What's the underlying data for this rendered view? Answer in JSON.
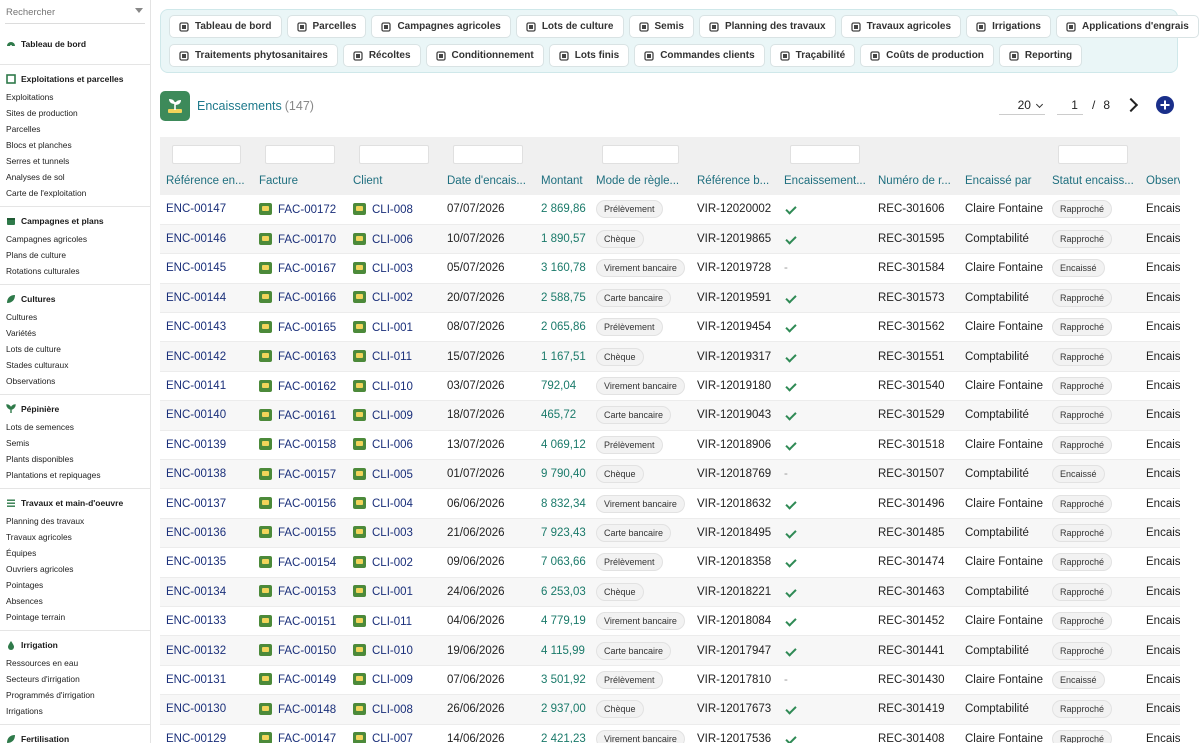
{
  "sidebar": {
    "search_placeholder": "Rechercher",
    "dashboard": "Tableau de bord",
    "groups": [
      {
        "title": "Exploitations et parcelles",
        "items": [
          "Exploitations",
          "Sites de production",
          "Parcelles",
          "Blocs et planches",
          "Serres et tunnels",
          "Analyses de sol",
          "Carte de l'exploitation"
        ]
      },
      {
        "title": "Campagnes et plans",
        "items": [
          "Campagnes agricoles",
          "Plans de culture",
          "Rotations culturales"
        ]
      },
      {
        "title": "Cultures",
        "items": [
          "Cultures",
          "Variétés",
          "Lots de culture",
          "Stades culturaux",
          "Observations"
        ]
      },
      {
        "title": "Pépinière",
        "items": [
          "Lots de semences",
          "Semis",
          "Plants disponibles",
          "Plantations et repiquages"
        ]
      },
      {
        "title": "Travaux et main-d'oeuvre",
        "items": [
          "Planning des travaux",
          "Travaux agricoles",
          "Équipes",
          "Ouvriers agricoles",
          "Pointages",
          "Absences",
          "Pointage terrain"
        ]
      },
      {
        "title": "Irrigation",
        "items": [
          "Ressources en eau",
          "Secteurs d'irrigation",
          "Programmés d'irrigation",
          "Irrigations"
        ]
      },
      {
        "title": "Fertilisation",
        "items": []
      }
    ]
  },
  "topnav": {
    "row1": [
      "Tableau de bord",
      "Parcelles",
      "Campagnes agricoles",
      "Lots de culture",
      "Semis",
      "Planning des travaux",
      "Travaux agricoles",
      "Irrigations",
      "Applications d'engrais"
    ],
    "row2": [
      "Traitements phytosanitaires",
      "Récoltes",
      "Conditionnement",
      "Lots finis",
      "Commandes clients",
      "Traçabilité",
      "Coûts de production",
      "Reporting"
    ]
  },
  "page": {
    "title": "Encaissements",
    "count": "(147)",
    "per_page": "20",
    "current_page": "1",
    "page_sep": "/",
    "total_pages": "8"
  },
  "table": {
    "columns": [
      "Référence en...",
      "Facture",
      "Client",
      "Date d'encais...",
      "Montant",
      "Mode de règle...",
      "Référence b...",
      "Encaissement...",
      "Numéro de r...",
      "Encaissé par",
      "Statut encaiss...",
      "Observ"
    ],
    "rows": [
      {
        "ref": "ENC-00147",
        "facture": "FAC-00172",
        "client": "CLI-008",
        "date": "07/07/2026",
        "montant": "2 869,86",
        "mode": "Prélèvement",
        "refb": "VIR-12020002",
        "enc": true,
        "num": "REC-301606",
        "par": "Claire Fontaine",
        "statut": "Rapproché",
        "obs": "Encais"
      },
      {
        "ref": "ENC-00146",
        "facture": "FAC-00170",
        "client": "CLI-006",
        "date": "10/07/2026",
        "montant": "1 890,57",
        "mode": "Chèque",
        "refb": "VIR-12019865",
        "enc": true,
        "num": "REC-301595",
        "par": "Comptabilité",
        "statut": "Rapproché",
        "obs": "Encais"
      },
      {
        "ref": "ENC-00145",
        "facture": "FAC-00167",
        "client": "CLI-003",
        "date": "05/07/2026",
        "montant": "3 160,78",
        "mode": "Virement bancaire",
        "refb": "VIR-12019728",
        "enc": false,
        "num": "REC-301584",
        "par": "Claire Fontaine",
        "statut": "Encaissé",
        "obs": "Encais"
      },
      {
        "ref": "ENC-00144",
        "facture": "FAC-00166",
        "client": "CLI-002",
        "date": "20/07/2026",
        "montant": "2 588,75",
        "mode": "Carte bancaire",
        "refb": "VIR-12019591",
        "enc": true,
        "num": "REC-301573",
        "par": "Comptabilité",
        "statut": "Rapproché",
        "obs": "Encais"
      },
      {
        "ref": "ENC-00143",
        "facture": "FAC-00165",
        "client": "CLI-001",
        "date": "08/07/2026",
        "montant": "2 065,86",
        "mode": "Prélèvement",
        "refb": "VIR-12019454",
        "enc": true,
        "num": "REC-301562",
        "par": "Claire Fontaine",
        "statut": "Rapproché",
        "obs": "Encais"
      },
      {
        "ref": "ENC-00142",
        "facture": "FAC-00163",
        "client": "CLI-011",
        "date": "15/07/2026",
        "montant": "1 167,51",
        "mode": "Chèque",
        "refb": "VIR-12019317",
        "enc": true,
        "num": "REC-301551",
        "par": "Comptabilité",
        "statut": "Rapproché",
        "obs": "Encais"
      },
      {
        "ref": "ENC-00141",
        "facture": "FAC-00162",
        "client": "CLI-010",
        "date": "03/07/2026",
        "montant": "792,04",
        "mode": "Virement bancaire",
        "refb": "VIR-12019180",
        "enc": true,
        "num": "REC-301540",
        "par": "Claire Fontaine",
        "statut": "Rapproché",
        "obs": "Encais"
      },
      {
        "ref": "ENC-00140",
        "facture": "FAC-00161",
        "client": "CLI-009",
        "date": "18/07/2026",
        "montant": "465,72",
        "mode": "Carte bancaire",
        "refb": "VIR-12019043",
        "enc": true,
        "num": "REC-301529",
        "par": "Comptabilité",
        "statut": "Rapproché",
        "obs": "Encais"
      },
      {
        "ref": "ENC-00139",
        "facture": "FAC-00158",
        "client": "CLI-006",
        "date": "13/07/2026",
        "montant": "4 069,12",
        "mode": "Prélèvement",
        "refb": "VIR-12018906",
        "enc": true,
        "num": "REC-301518",
        "par": "Claire Fontaine",
        "statut": "Rapproché",
        "obs": "Encais"
      },
      {
        "ref": "ENC-00138",
        "facture": "FAC-00157",
        "client": "CLI-005",
        "date": "01/07/2026",
        "montant": "9 790,40",
        "mode": "Chèque",
        "refb": "VIR-12018769",
        "enc": false,
        "num": "REC-301507",
        "par": "Comptabilité",
        "statut": "Encaissé",
        "obs": "Encais"
      },
      {
        "ref": "ENC-00137",
        "facture": "FAC-00156",
        "client": "CLI-004",
        "date": "06/06/2026",
        "montant": "8 832,34",
        "mode": "Virement bancaire",
        "refb": "VIR-12018632",
        "enc": true,
        "num": "REC-301496",
        "par": "Claire Fontaine",
        "statut": "Rapproché",
        "obs": "Encais"
      },
      {
        "ref": "ENC-00136",
        "facture": "FAC-00155",
        "client": "CLI-003",
        "date": "21/06/2026",
        "montant": "7 923,43",
        "mode": "Carte bancaire",
        "refb": "VIR-12018495",
        "enc": true,
        "num": "REC-301485",
        "par": "Comptabilité",
        "statut": "Rapproché",
        "obs": "Encais"
      },
      {
        "ref": "ENC-00135",
        "facture": "FAC-00154",
        "client": "CLI-002",
        "date": "09/06/2026",
        "montant": "7 063,66",
        "mode": "Prélèvement",
        "refb": "VIR-12018358",
        "enc": true,
        "num": "REC-301474",
        "par": "Claire Fontaine",
        "statut": "Rapproché",
        "obs": "Encais"
      },
      {
        "ref": "ENC-00134",
        "facture": "FAC-00153",
        "client": "CLI-001",
        "date": "24/06/2026",
        "montant": "6 253,03",
        "mode": "Chèque",
        "refb": "VIR-12018221",
        "enc": true,
        "num": "REC-301463",
        "par": "Comptabilité",
        "statut": "Rapproché",
        "obs": "Encais"
      },
      {
        "ref": "ENC-00133",
        "facture": "FAC-00151",
        "client": "CLI-011",
        "date": "04/06/2026",
        "montant": "4 779,19",
        "mode": "Virement bancaire",
        "refb": "VIR-12018084",
        "enc": true,
        "num": "REC-301452",
        "par": "Claire Fontaine",
        "statut": "Rapproché",
        "obs": "Encais"
      },
      {
        "ref": "ENC-00132",
        "facture": "FAC-00150",
        "client": "CLI-010",
        "date": "19/06/2026",
        "montant": "4 115,99",
        "mode": "Carte bancaire",
        "refb": "VIR-12017947",
        "enc": true,
        "num": "REC-301441",
        "par": "Comptabilité",
        "statut": "Rapproché",
        "obs": "Encais"
      },
      {
        "ref": "ENC-00131",
        "facture": "FAC-00149",
        "client": "CLI-009",
        "date": "07/06/2026",
        "montant": "3 501,92",
        "mode": "Prélèvement",
        "refb": "VIR-12017810",
        "enc": false,
        "num": "REC-301430",
        "par": "Claire Fontaine",
        "statut": "Encaissé",
        "obs": "Encais"
      },
      {
        "ref": "ENC-00130",
        "facture": "FAC-00148",
        "client": "CLI-008",
        "date": "26/06/2026",
        "montant": "2 937,00",
        "mode": "Chèque",
        "refb": "VIR-12017673",
        "enc": true,
        "num": "REC-301419",
        "par": "Comptabilité",
        "statut": "Rapproché",
        "obs": "Encais"
      },
      {
        "ref": "ENC-00129",
        "facture": "FAC-00147",
        "client": "CLI-007",
        "date": "14/06/2026",
        "montant": "2 421,23",
        "mode": "Virement bancaire",
        "refb": "VIR-12017536",
        "enc": true,
        "num": "REC-301408",
        "par": "Claire Fontaine",
        "statut": "Rapproché",
        "obs": "Encais"
      }
    ]
  },
  "icons": {
    "dashboard": "gauge-icon",
    "accent": "#1f7a8c",
    "link": "#1a2f7a",
    "amount": "#1a7a6a",
    "add_button": "#1a2f8a"
  }
}
